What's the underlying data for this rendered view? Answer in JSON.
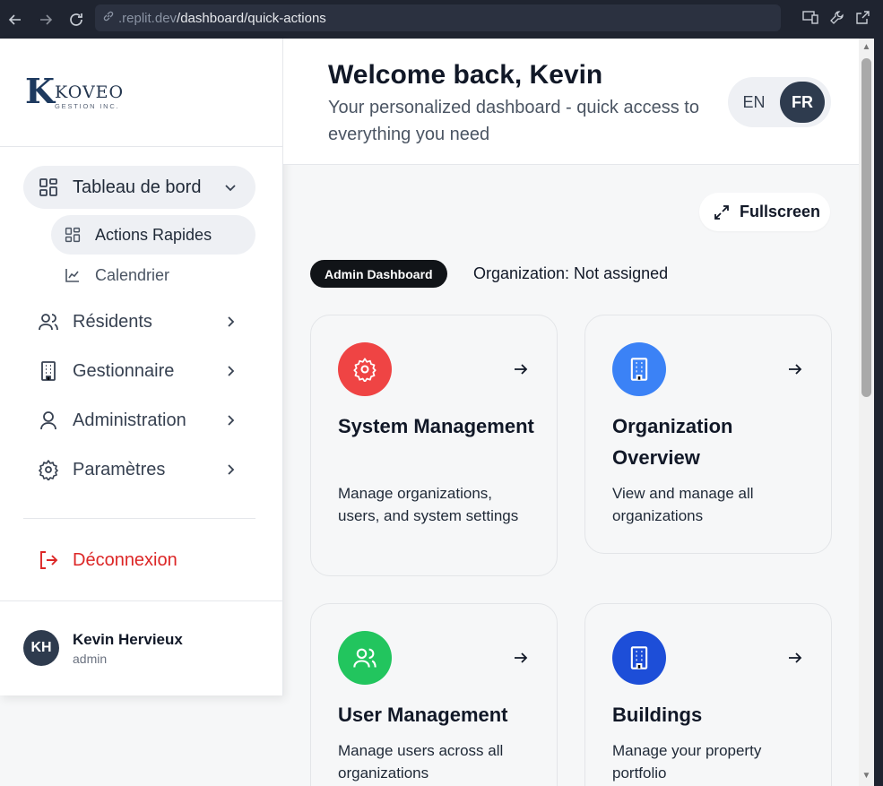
{
  "browser": {
    "url_host": ".replit.dev",
    "url_path": "/dashboard/quick-actions"
  },
  "sidebar": {
    "logo_letter": "K",
    "logo_name": "KOVEO",
    "logo_sub": "GESTION INC.",
    "nav": [
      {
        "label": "Tableau de bord",
        "icon": "dashboard-icon",
        "expanded": true
      },
      {
        "label": "Résidents",
        "icon": "users-icon"
      },
      {
        "label": "Gestionnaire",
        "icon": "building-icon"
      },
      {
        "label": "Administration",
        "icon": "user-icon"
      },
      {
        "label": "Paramètres",
        "icon": "gear-icon"
      }
    ],
    "subnav": [
      {
        "label": "Actions Rapides",
        "icon": "dashboard-icon",
        "active": true
      },
      {
        "label": "Calendrier",
        "icon": "chart-icon"
      }
    ],
    "logout_label": "Déconnexion",
    "user": {
      "initials": "KH",
      "name": "Kevin Hervieux",
      "role": "admin"
    }
  },
  "header": {
    "title": "Welcome back, Kevin",
    "subtitle": "Your personalized dashboard - quick access to everything you need",
    "lang_en": "EN",
    "lang_fr": "FR",
    "lang_selected": "FR"
  },
  "toolbar": {
    "fullscreen_label": "Fullscreen"
  },
  "context": {
    "badge": "Admin Dashboard",
    "organization": "Organization: Not assigned"
  },
  "cards": [
    {
      "title": "System Management",
      "description": "Manage organizations, users, and system settings",
      "icon": "gear-icon",
      "color": "#ef4444"
    },
    {
      "title": "Organization Overview",
      "description": "View and manage all organizations",
      "icon": "building-icon",
      "color": "#3b82f6"
    },
    {
      "title": "User Management",
      "description": "Manage users across all organizations",
      "icon": "users-icon",
      "color": "#22c55e"
    },
    {
      "title": "Buildings",
      "description": "Manage your property portfolio",
      "icon": "building-icon",
      "color": "#1d4ed8"
    }
  ]
}
